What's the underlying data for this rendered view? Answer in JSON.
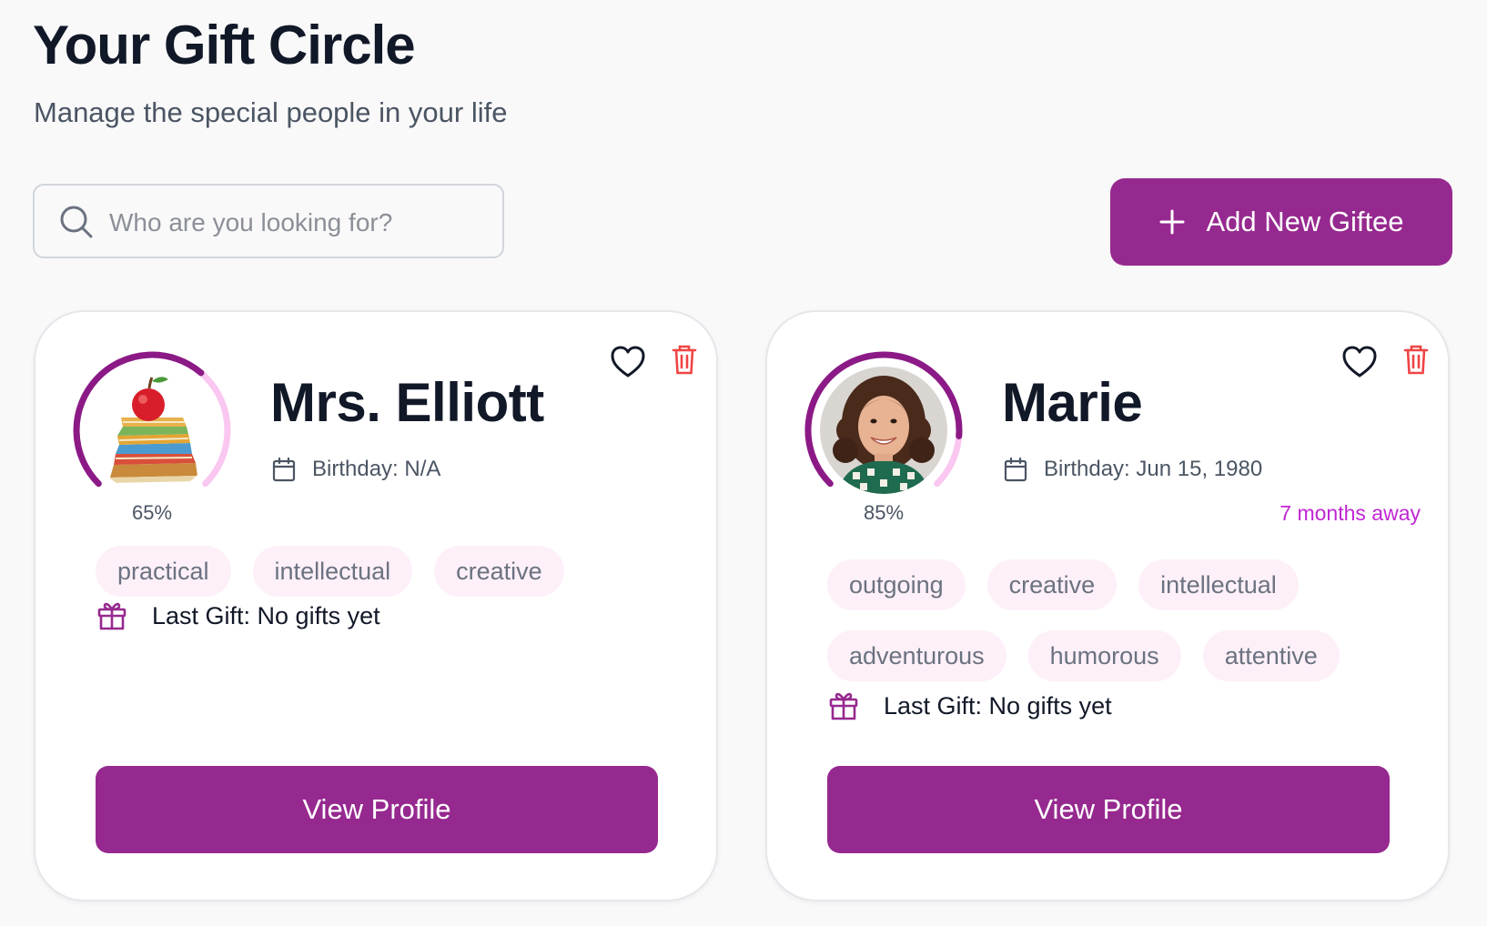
{
  "header": {
    "title": "Your Gift Circle",
    "subtitle": "Manage the special people in your life"
  },
  "search": {
    "placeholder": "Who are you looking for?",
    "value": "",
    "icon": "search-icon"
  },
  "actions": {
    "add_label": "Add New Giftee",
    "add_icon": "plus-icon"
  },
  "colors": {
    "accent": "#96298f",
    "ring_progress": "#8b1a86",
    "ring_track": "#f9c7f0",
    "tag_bg": "#fdf0f8",
    "delete": "#ef4444",
    "away_text": "#c026d3"
  },
  "giftees": [
    {
      "name": "Mrs. Elliott",
      "completion": 65,
      "completion_label": "65%",
      "birthday_label": "Birthday: N/A",
      "away": "",
      "tags": [
        "practical",
        "intellectual",
        "creative"
      ],
      "last_gift_label": "Last Gift: No gifts yet",
      "view_label": "View Profile",
      "avatar": "apple-on-books-illustration"
    },
    {
      "name": "Marie",
      "completion": 85,
      "completion_label": "85%",
      "birthday_label": "Birthday: Jun 15, 1980",
      "away": "7 months away",
      "tags": [
        "outgoing",
        "creative",
        "intellectual",
        "adventurous",
        "humorous",
        "attentive"
      ],
      "last_gift_label": "Last Gift: No gifts yet",
      "view_label": "View Profile",
      "avatar": "woman-portrait-photo"
    }
  ]
}
